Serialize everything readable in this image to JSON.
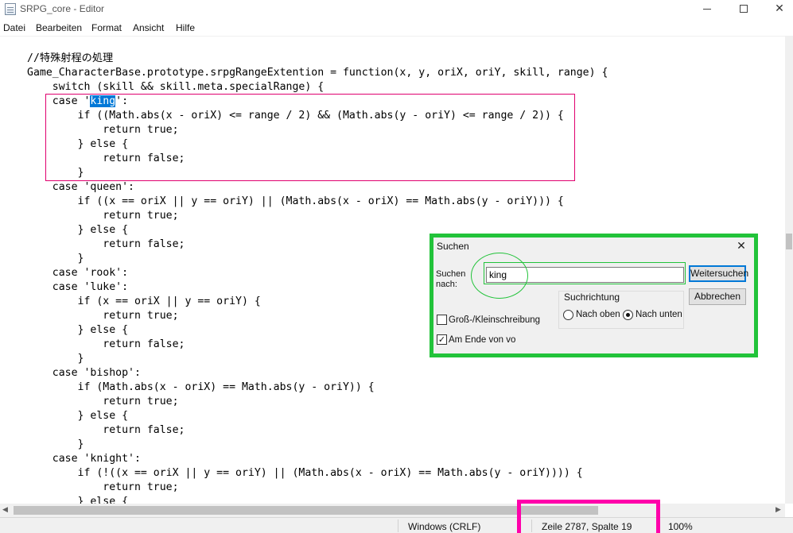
{
  "window": {
    "title": "SRPG_core - Editor",
    "minimize_icon": "minimize-icon",
    "maximize_icon": "maximize-icon",
    "close_glyph": "✕"
  },
  "menu": [
    "Datei",
    "Bearbeiten",
    "Format",
    "Ansicht",
    "Hilfe"
  ],
  "editor": {
    "lines": [
      "",
      "//特殊射程の処理",
      "Game_CharacterBase.prototype.srpgRangeExtention = function(x, y, oriX, oriY, skill, range) {",
      "    switch (skill && skill.meta.specialRange) {",
      "    case 'king':",
      "        if ((Math.abs(x - oriX) <= range / 2) && (Math.abs(y - oriY) <= range / 2)) {",
      "            return true;",
      "        } else {",
      "            return false;",
      "        }",
      "    case 'queen':",
      "        if ((x == oriX || y == oriY) || (Math.abs(x - oriX) == Math.abs(y - oriY))) {",
      "            return true;",
      "        } else {",
      "            return false;",
      "        }",
      "    case 'rook':",
      "    case 'luke':",
      "        if (x == oriX || y == oriY) {",
      "            return true;",
      "        } else {",
      "            return false;",
      "        }",
      "    case 'bishop':",
      "        if (Math.abs(x - oriX) == Math.abs(y - oriY)) {",
      "            return true;",
      "        } else {",
      "            return false;",
      "        }",
      "    case 'knight':",
      "        if (!((x == oriX || y == oriY) || (Math.abs(x - oriX) == Math.abs(y - oriY)))) {",
      "            return true;",
      "        } else {"
    ],
    "selection": {
      "line": 4,
      "text": "king"
    }
  },
  "status": {
    "line_ending": "Windows (CRLF)",
    "position": "Zeile 2787, Spalte 19",
    "zoom": "100%"
  },
  "find_dialog": {
    "title": "Suchen",
    "search_label": "Suchen nach:",
    "search_value": "king",
    "find_next": "Weitersuchen",
    "cancel": "Abbrechen",
    "direction_label": "Suchrichtung",
    "direction_up": "Nach oben",
    "direction_down": "Nach unten",
    "direction_selected": "down",
    "match_case": "Groß-/Kleinschreibung",
    "match_case_checked": false,
    "wrap_around": "Am Ende von vo",
    "wrap_around_checked": true
  },
  "annotations": {
    "king_box_color": "#e0006e",
    "status_box_color": "#ff00aa",
    "dialog_box_color": "#22c33a"
  }
}
